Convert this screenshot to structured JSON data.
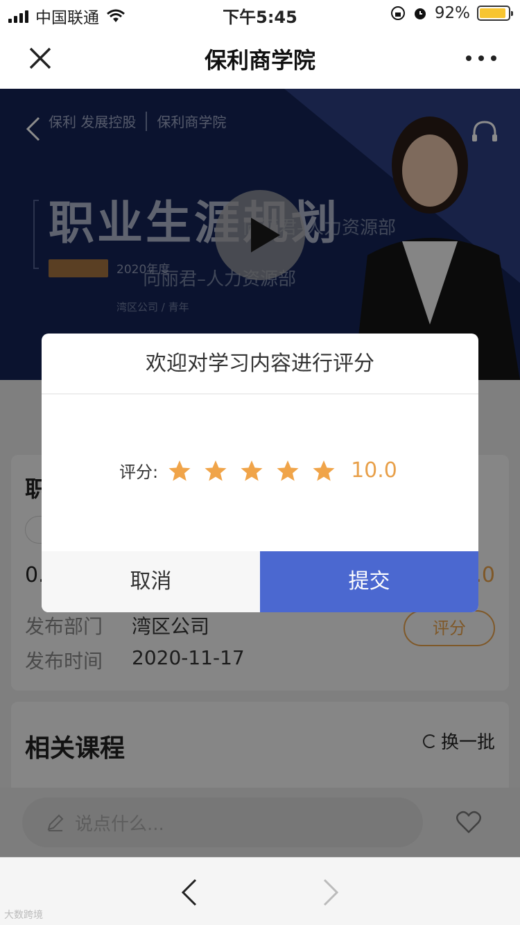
{
  "status_bar": {
    "carrier": "中国联通",
    "time": "下午5:45",
    "battery": "92%",
    "battery_level": 0.92
  },
  "nav": {
    "title": "保利商学院"
  },
  "banner": {
    "logo_left": "保利 发展控股",
    "logo_right": "保利商学院",
    "big_title": "职业生涯规划",
    "subtitle": "2020年度",
    "company": "湾区公司 / 青年",
    "watermark_1": "向丽君–人力资源部",
    "watermark_2": "向丽君–人力资源部"
  },
  "course_card": {
    "title_partial": "职",
    "score_left": "0.",
    "score_right": ".0",
    "dept_label": "发布部门",
    "dept_value": "湾区公司",
    "time_label": "发布时间",
    "time_value": "2020-11-17",
    "rate_button": "评分"
  },
  "related": {
    "heading": "相关课程",
    "refresh": "换一批"
  },
  "comment": {
    "placeholder": "说点什么..."
  },
  "dialog": {
    "title": "欢迎对学习内容进行评分",
    "rating_label": "评分:",
    "rating_value": "10.0",
    "stars": 5,
    "cancel": "取消",
    "submit": "提交",
    "star_color": "#f0a449",
    "submit_color": "#4b68d0"
  },
  "footer_watermark": "大数跨境"
}
